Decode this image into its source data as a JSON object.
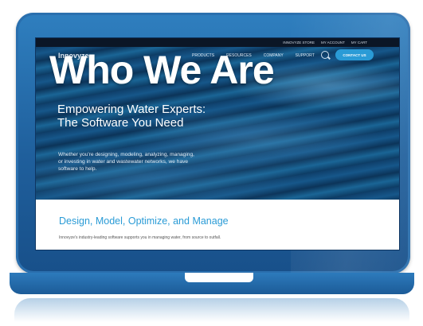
{
  "overlay": {
    "title": "Who We Are"
  },
  "site": {
    "topbar": {
      "store": "INNOVYZE STORE",
      "account": "MY ACCOUNT",
      "cart": "MY CART"
    },
    "logo": "Innovyze",
    "nav": {
      "items": [
        "PRODUCTS",
        "RESOURCES",
        "COMPANY",
        "SUPPORT"
      ],
      "contact": "CONTACT US"
    },
    "hero": {
      "headline": "Empowering Water Experts: The Software You Need",
      "subtext": "Whether you're designing, modeling, analyzing, managing, or investing in water and wastewater networks, we have software to help."
    },
    "section": {
      "title": "Design, Model, Optimize, and Manage",
      "desc": "Innovyze's industry-leading software supports you in managing water, from source to outfall."
    }
  },
  "icons": [
    "search-icon",
    "chevron-down-icon"
  ],
  "colors": {
    "frame": "#1f5f9c",
    "accent": "#2a9bd6",
    "topbar": "#0b1626"
  }
}
